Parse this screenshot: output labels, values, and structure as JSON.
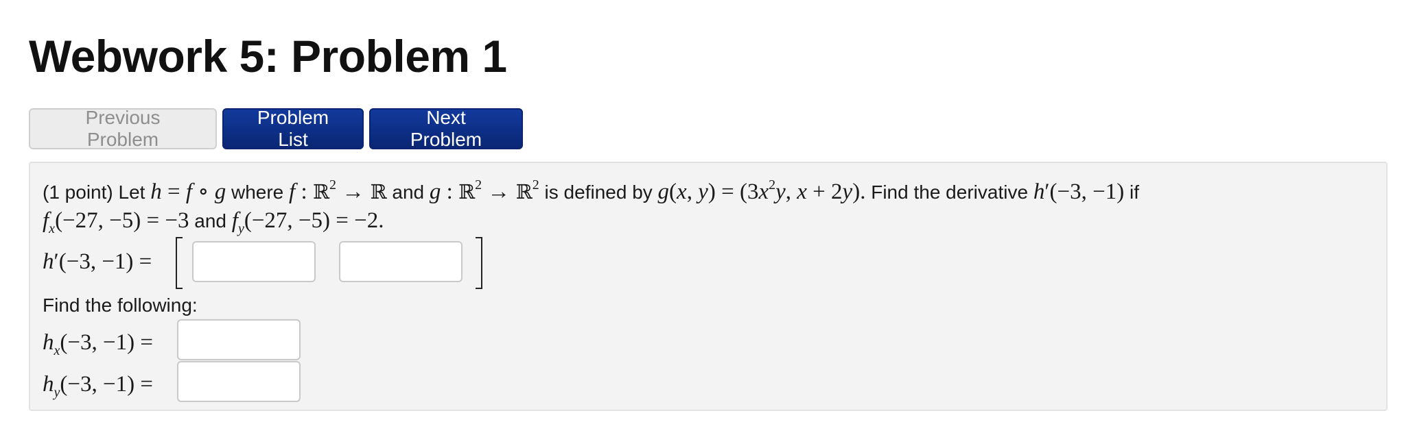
{
  "page": {
    "title": "Webwork 5: Problem 1"
  },
  "nav": {
    "previous_label": "Previous Problem",
    "list_label": "Problem List",
    "next_label": "Next Problem"
  },
  "problem": {
    "points": "(1 point)",
    "let": "Let",
    "where": "where",
    "and": "and",
    "is_defined_by": "is defined by",
    "find_derivative": "Find the derivative",
    "if": "if",
    "and2": "and",
    "period": ".",
    "find_following": "Find the following:",
    "h_prime_label": "h′(−3,−1) =",
    "hx_label": "hx(−3,−1) =",
    "hy_label": "hy(−3,−1) =",
    "answers": {
      "h_prime_1": "",
      "h_prime_2": "",
      "hx": "",
      "hy": ""
    }
  }
}
